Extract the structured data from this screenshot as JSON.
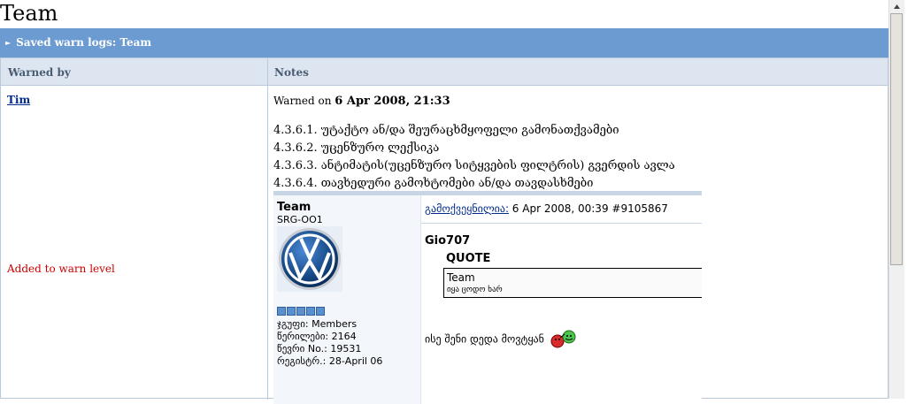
{
  "page": {
    "title": "Team"
  },
  "section": {
    "title": "Saved warn logs: Team"
  },
  "columns": {
    "warned_by": "Warned by",
    "notes": "Notes"
  },
  "entry": {
    "warned_by_user": "Tim",
    "level_change": "Added to warn level",
    "warned_on_label": "Warned on",
    "warned_on_date": "6 Apr 2008, 21:33",
    "rules": [
      "4.3.6.1. უტაქტო ან/და შეურაცხმყოფელი გამონათქვამები",
      "4.3.6.2. უცენზურო ლექსიკა",
      "4.3.6.3. ანტიმატის(უცენზურო სიტყვების ფილტრის) გვერდის ავლა",
      "4.3.6.4. თავხედური გამოხტომები ან/და თავდასხმები"
    ]
  },
  "post": {
    "author_name": "Team",
    "author_group_id": "SRG-OO1",
    "avatar_icon": "volkswagen-logo",
    "info": {
      "group": "ჯგუფი: Members",
      "posts": "წერილები: 2164",
      "member_no": "წევრი No.: 19531",
      "registered": "რეგისტრ.: 28-April 06"
    },
    "posted_label": "გამოქვეყნილია:",
    "posted_date": " 6 Apr 2008, 00:39  #9105867",
    "quote_author": "Gio707",
    "quote_title": "QUOTE",
    "quote_inner_author": "Team",
    "quote_inner_text": "იყა ცოდო ხარ",
    "message": "ისე შენი დედა მოვტყან"
  },
  "colors": {
    "header_bar": "#6B9BD0",
    "table_header": "#DDE6F0",
    "link": "#002b8c",
    "warn_red": "#d00000"
  }
}
